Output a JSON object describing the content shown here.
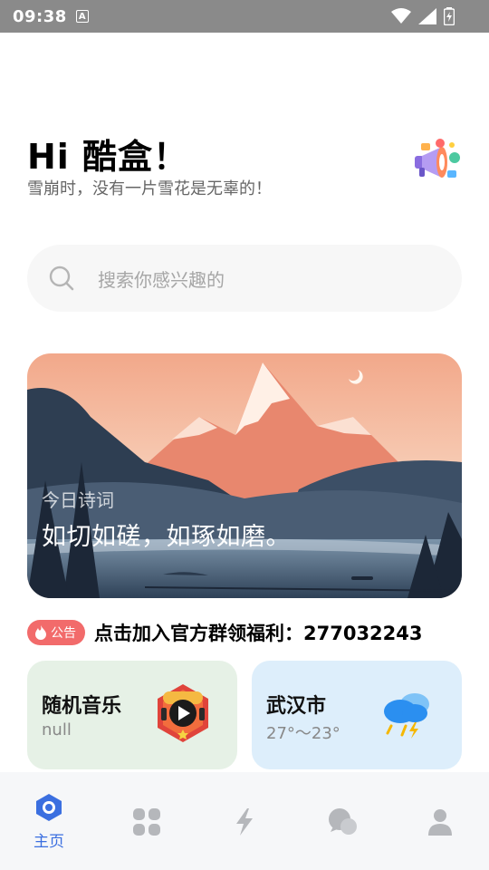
{
  "status_bar": {
    "time": "09:38",
    "keyboard_indicator": "A"
  },
  "header": {
    "greeting": "Hi 酷盒！",
    "subtitle": "雪崩时，没有一片雪花是无辜的！"
  },
  "search": {
    "placeholder": "搜索你感兴趣的"
  },
  "poem": {
    "label": "今日诗词",
    "text": "如切如磋，如琢如磨。"
  },
  "notice": {
    "badge": "公告",
    "text": "点击加入官方群领福利：277032243"
  },
  "music": {
    "title": "随机音乐",
    "subtitle": "null"
  },
  "weather": {
    "city": "武汉市",
    "temperature": "27°～23°",
    "condition_icon": "thunder-rain-icon"
  },
  "nav": {
    "items": [
      {
        "label": "主页",
        "icon": "home-icon",
        "active": true
      },
      {
        "label": "",
        "icon": "apps-icon"
      },
      {
        "label": "",
        "icon": "lightning-icon"
      },
      {
        "label": "",
        "icon": "chat-icon"
      },
      {
        "label": "",
        "icon": "user-icon"
      }
    ]
  },
  "colors": {
    "accent": "#3b6fe0",
    "notice_badge": "#f26b6b",
    "music_card": "#e6f1e6",
    "weather_card": "#ddeefb"
  }
}
